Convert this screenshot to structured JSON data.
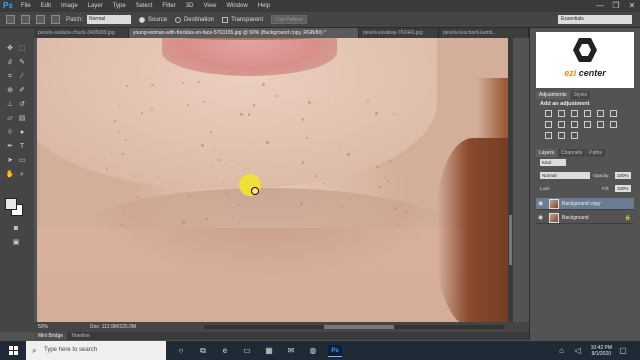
{
  "app": {
    "logo": "Ps",
    "menu": [
      "File",
      "Edit",
      "Image",
      "Layer",
      "Type",
      "Select",
      "Filter",
      "3D",
      "View",
      "Window",
      "Help"
    ],
    "window_controls": [
      "—",
      "❐",
      "✕"
    ]
  },
  "options_bar": {
    "patch_label": "Patch:",
    "patch_value": "Normal",
    "source_label": "Source",
    "destination_label": "Destination",
    "transparent_label": "Transparent",
    "use_pattern_label": "Use Pattern",
    "workspace": "Essentials"
  },
  "tabs": [
    "pexels-wallace-chuck-3435909.jpg",
    "young-woman-with-freckles-on-face-5763155.jpg @ 50% (Background copy, RGB/8#) *",
    "pexels-pixabay-762441.jpg",
    "pexels-teachard-kumb..."
  ],
  "status": {
    "zoom": "50%",
    "doc": "Doc: 112.9M/225.0M"
  },
  "bottom_tabs": [
    "Mini Bridge",
    "Timeline"
  ],
  "logo_card": {
    "text_orange": "ezi",
    "text_dark": " center"
  },
  "panels": {
    "adj_tabs": [
      "Adjustments",
      "Styles"
    ],
    "adj_title": "Add an adjustment",
    "layer_tabs": [
      "Layers",
      "Channels",
      "Paths"
    ],
    "kind": "Kind",
    "blend": "Normal",
    "opacity_label": "Opacity:",
    "opacity_value": "100%",
    "lock_label": "Lock:",
    "fill_label": "Fill:",
    "fill_value": "100%",
    "layers": [
      {
        "name": "Background copy",
        "selected": true
      },
      {
        "name": "Background",
        "selected": false
      }
    ]
  },
  "taskbar": {
    "search_placeholder": "Type here to search",
    "time": "10:42 PM",
    "date": "9/1/2020"
  },
  "icons": [
    "windows-icon",
    "search-icon",
    "task-view-icon",
    "edge-icon",
    "file-explorer-icon",
    "store-icon",
    "mail-icon",
    "chrome-icon",
    "photoshop-icon"
  ]
}
